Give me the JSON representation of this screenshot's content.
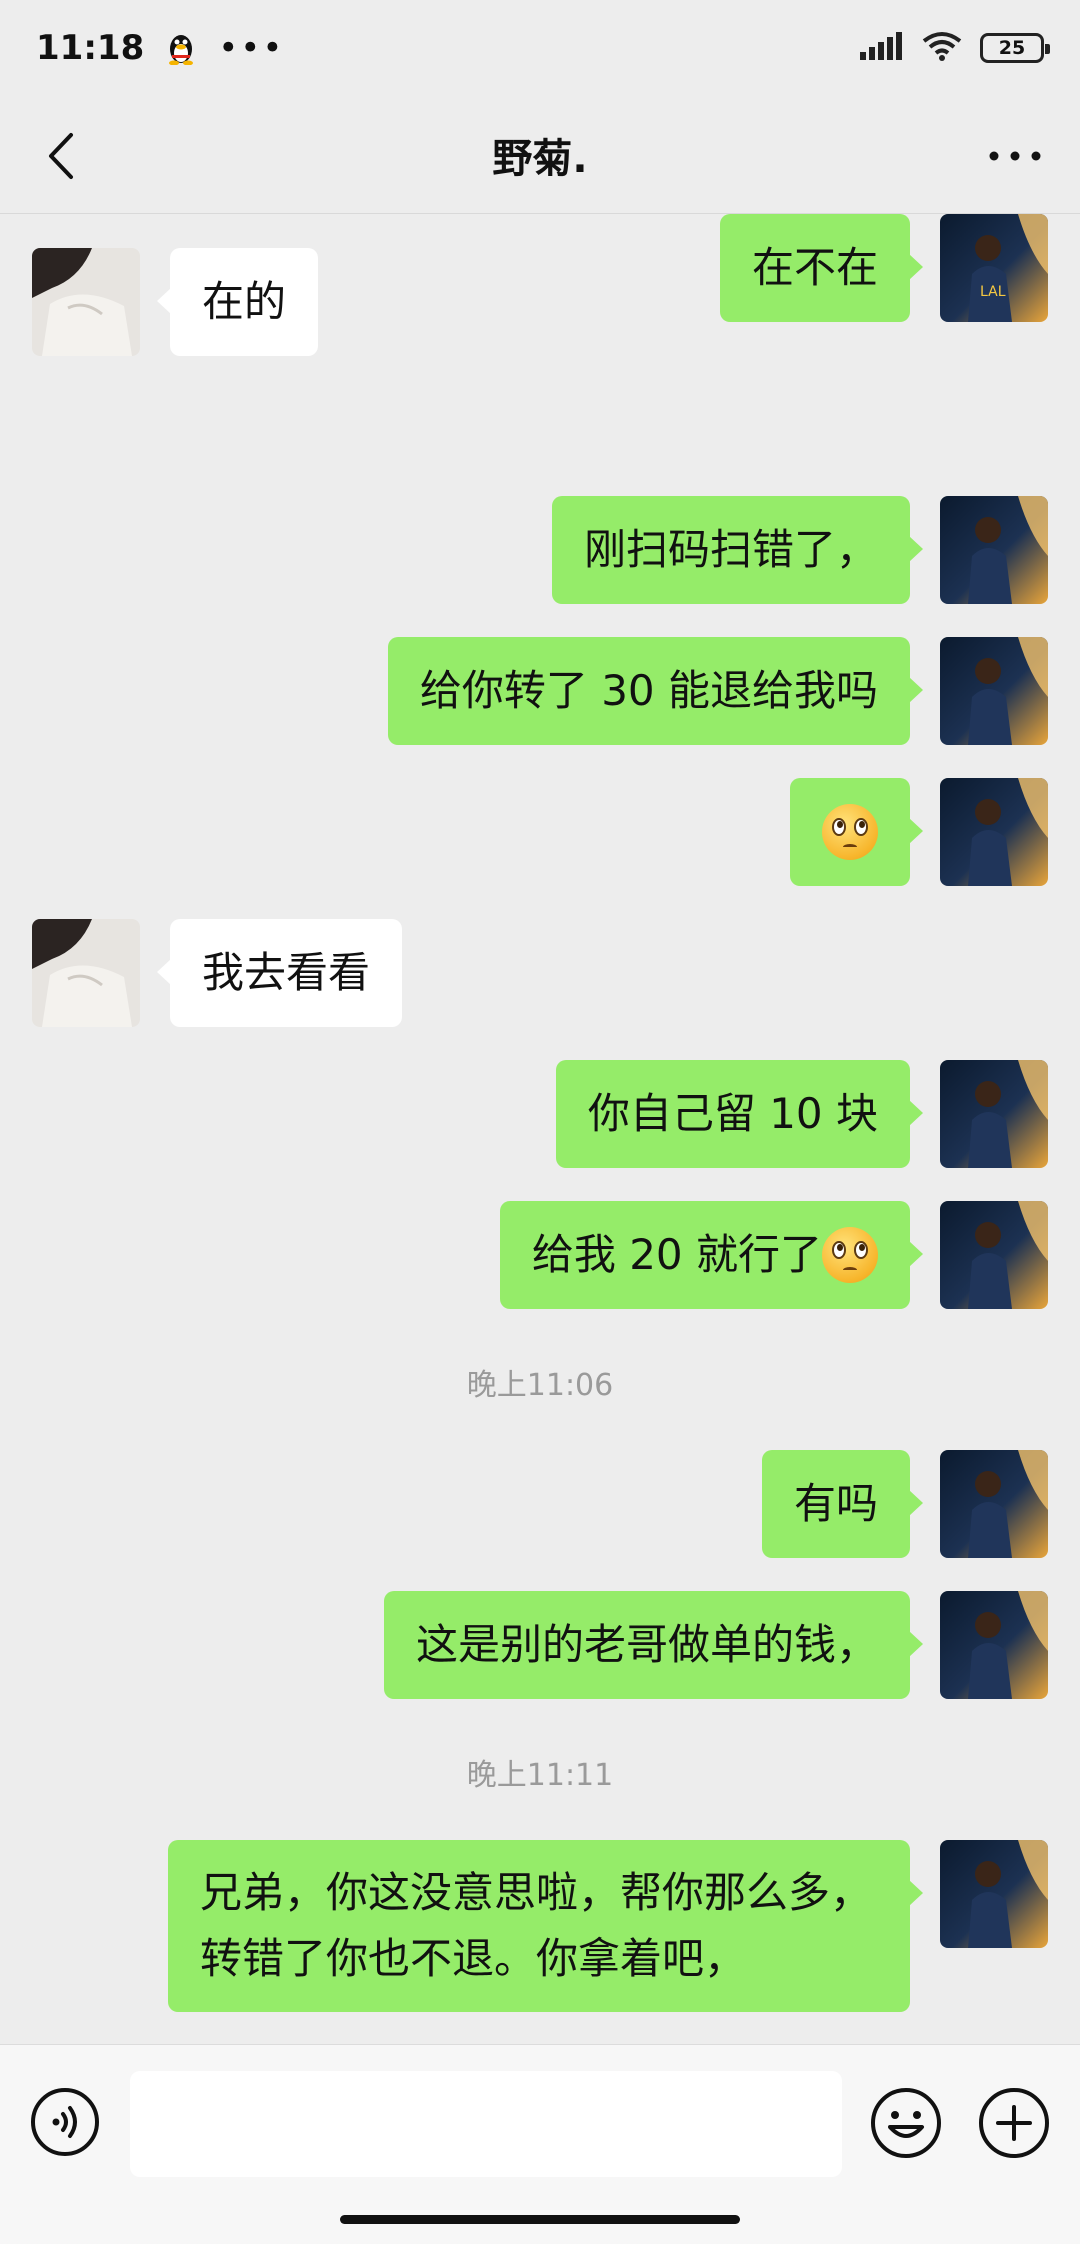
{
  "status_bar": {
    "time": "11:18",
    "battery": "25"
  },
  "header": {
    "title": "野菊."
  },
  "messages": {
    "m1": "在不在",
    "m2": "在的",
    "m3": "刚扫码扫错了，",
    "m4": "给你转了 30 能退给我吗",
    "m6": "我去看看",
    "m7": "你自己留 10 块",
    "m8": "给我 20 就行了",
    "ts1": "晚上11:06",
    "m9": "有吗",
    "m10": "这是别的老哥做单的钱，",
    "ts2": "晚上11:11",
    "m11_line1": "兄弟，你这没意思啦，帮你那么多，",
    "m11_line2": "转错了你也不退。你拿着吧，"
  },
  "input": {
    "value": ""
  },
  "icons": {
    "back": "back-arrow-icon",
    "more": "more-dots-icon",
    "voice": "voice-icon",
    "emoji": "smiley-icon",
    "plus": "plus-icon"
  },
  "colors": {
    "my_bubble": "#95ec69",
    "their_bubble": "#ffffff",
    "background": "#ededed"
  }
}
